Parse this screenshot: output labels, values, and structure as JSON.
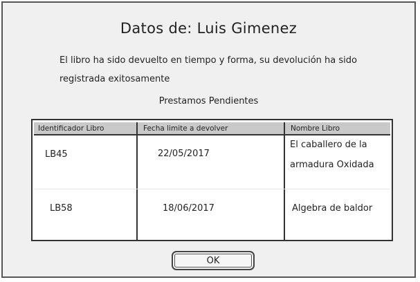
{
  "dialog": {
    "title": "Datos de: Luis Gimenez",
    "message": "El libro ha sido devuelto en tiempo y forma, su devolución ha sido registrada exitosamente",
    "subtitle": "Prestamos Pendientes",
    "ok_label": "OK"
  },
  "table": {
    "headers": [
      "Identificador Libro",
      "Fecha limite a devolver",
      "Nombre Libro"
    ],
    "rows": [
      [
        "LB45",
        "22/05/2017",
        "El caballero de la armadura Oxidada"
      ],
      [
        "LB58",
        "18/06/2017",
        "Algebra de baldor"
      ]
    ]
  },
  "colors": {
    "background": "#f0f0f0",
    "border": "#555555",
    "header_bg": "#c9c9c9",
    "table_bg": "#ffffff"
  }
}
